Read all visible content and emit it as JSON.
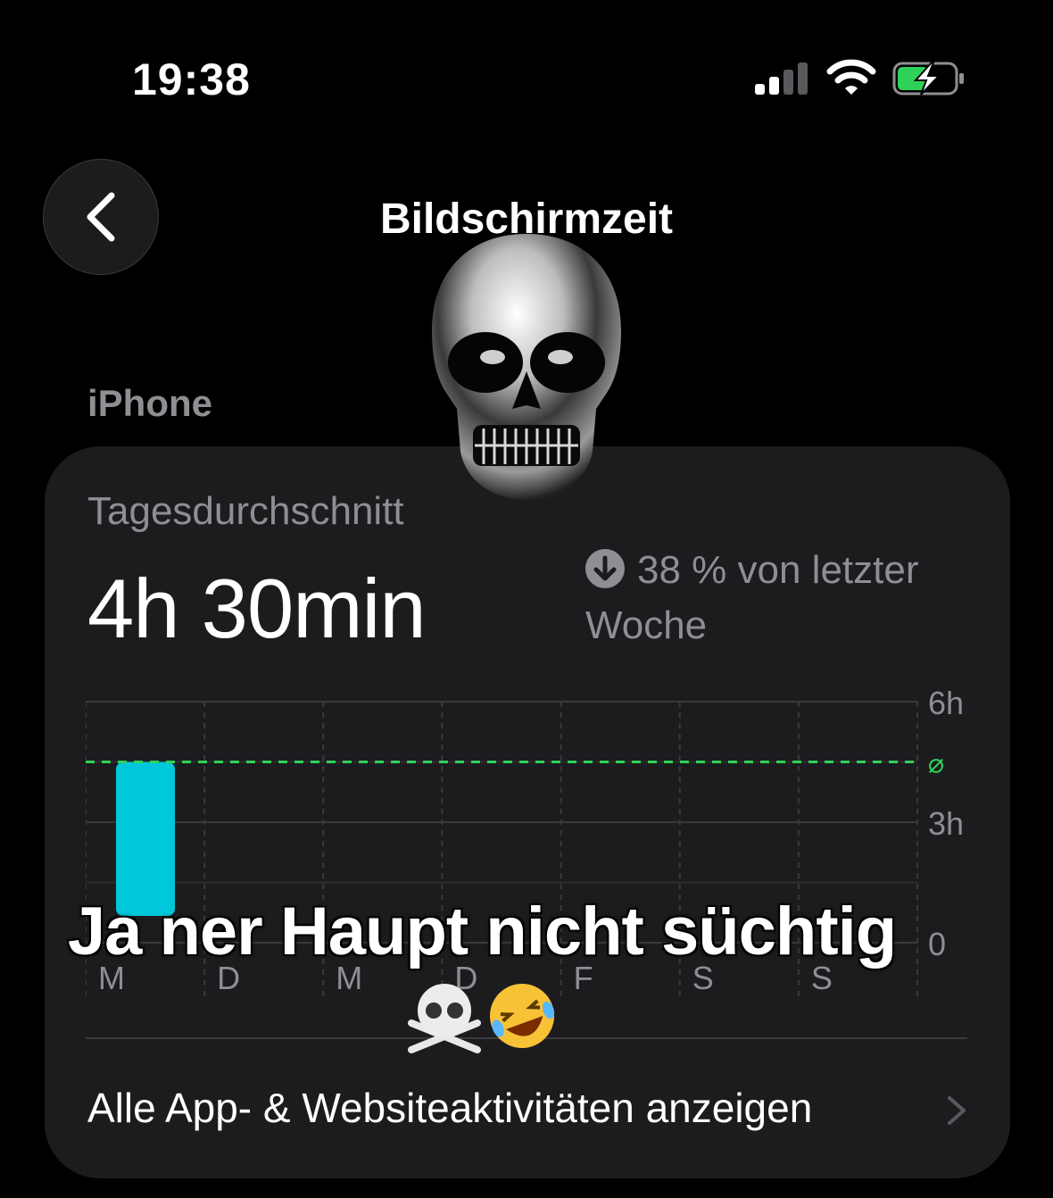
{
  "status_bar": {
    "time": "19:38",
    "battery_color": "#30d158"
  },
  "nav": {
    "title": "Bildschirmzeit"
  },
  "section": {
    "label": "iPhone"
  },
  "summary": {
    "average_label": "Tagesdurchschnitt",
    "average_value": "4h 30min",
    "change_line1": "38 % von letzter",
    "change_line2": "Woche",
    "change_icon": "arrow-down-circle-icon"
  },
  "chart_data": {
    "type": "bar",
    "categories": [
      "M",
      "D",
      "M",
      "D",
      "F",
      "S",
      "S"
    ],
    "values": [
      4.5,
      null,
      null,
      null,
      null,
      null,
      null
    ],
    "average": 4.5,
    "average_label": "⌀",
    "ylim": [
      0,
      6
    ],
    "y_ticks": [
      "6h",
      "3h",
      "0"
    ],
    "bar_color": "#00c7d9",
    "average_line_color": "#30d158",
    "grid": true
  },
  "footer": {
    "link_label": "Alle App- & Websiteaktivitäten anzeigen"
  },
  "overlay": {
    "caption": "Ja ner Haupt nicht süchtig",
    "emojis": [
      "skull-crossbones-emoji",
      "rofl-emoji"
    ]
  }
}
